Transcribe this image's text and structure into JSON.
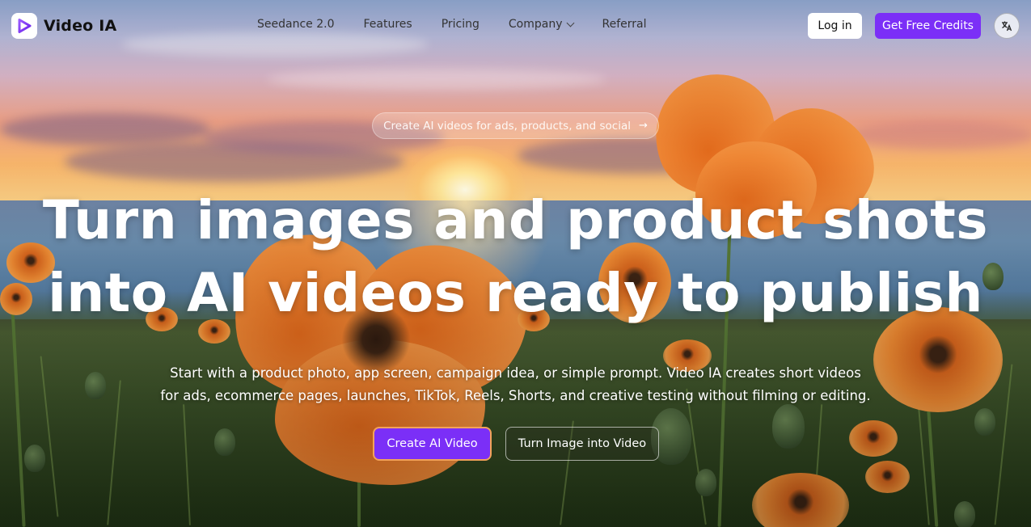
{
  "brand": {
    "name": "Video IA",
    "accent": "#7b2ff7",
    "logo_icon": "play-triangle-icon"
  },
  "nav": {
    "links": [
      {
        "label": "Seedance 2.0"
      },
      {
        "label": "Features"
      },
      {
        "label": "Pricing"
      },
      {
        "label": "Company",
        "has_dropdown": true
      },
      {
        "label": "Referral"
      }
    ],
    "login_label": "Log in",
    "credits_label": "Get Free Credits",
    "language_icon": "translate-icon"
  },
  "hero": {
    "pill_text": "Create AI videos for ads, products, and social",
    "pill_icon": "arrow-right-icon",
    "headline_line1": "Turn images and product shots",
    "headline_line2": "into AI videos ready to publish",
    "sub_line1": "Start with a product photo, app screen, campaign idea, or simple prompt. Video IA creates short videos",
    "sub_line2": "for ads, ecommerce pages, launches, TikTok, Reels, Shorts, and creative testing without filming or editing.",
    "primary_cta": "Create AI Video",
    "secondary_cta": "Turn Image into Video"
  }
}
